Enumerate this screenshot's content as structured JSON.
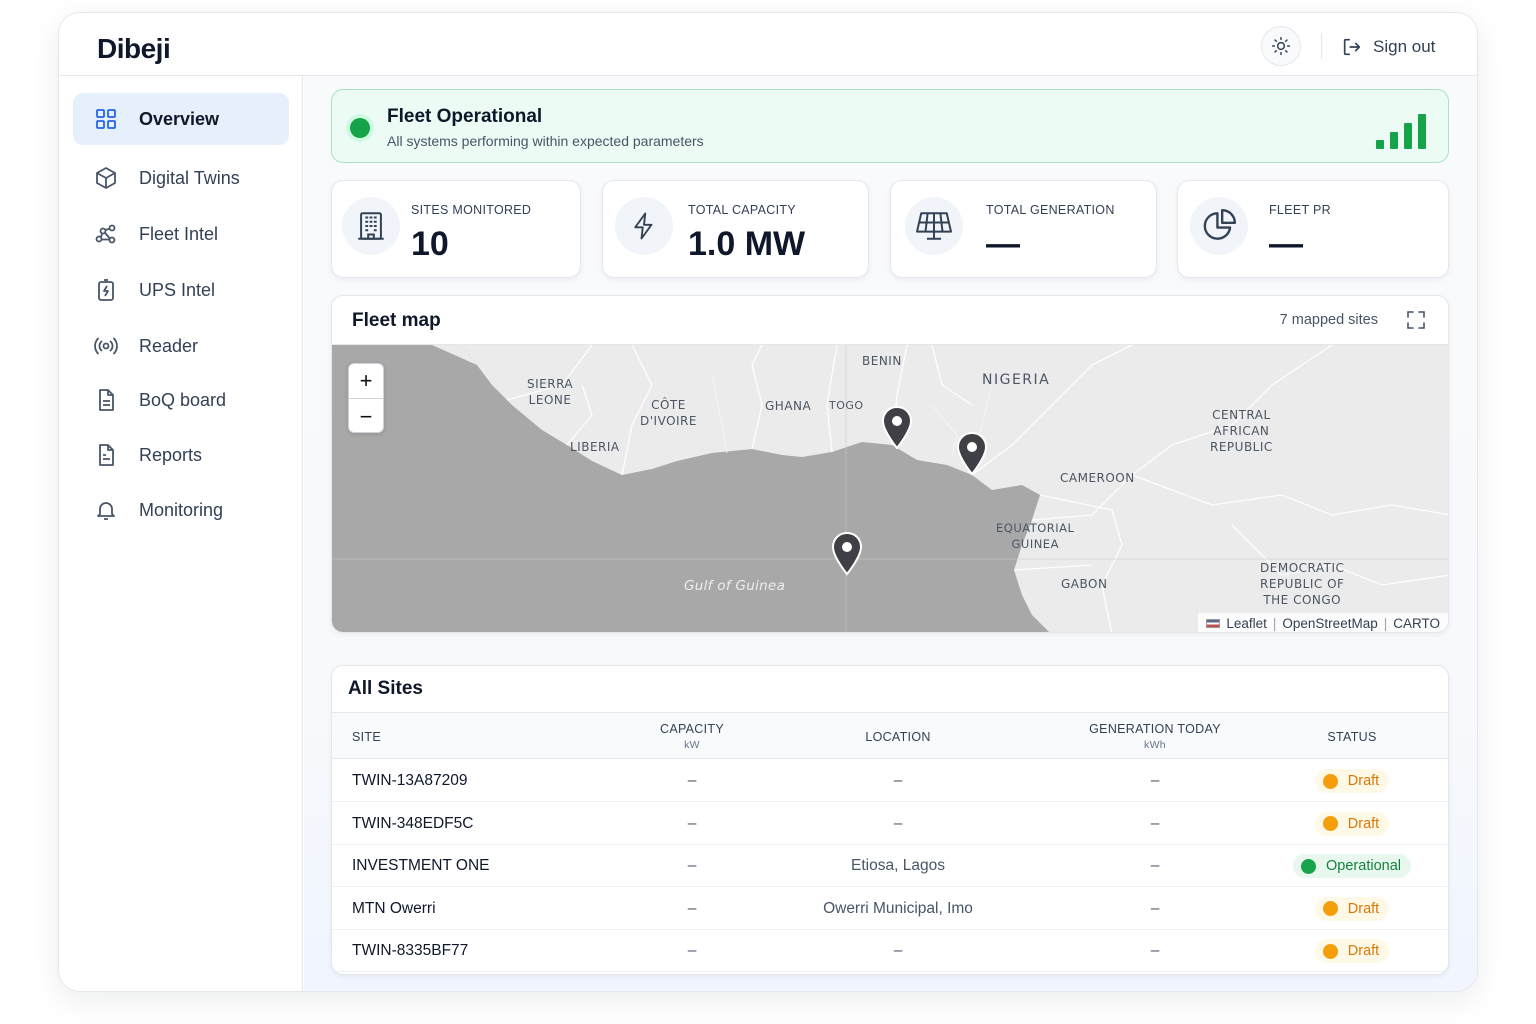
{
  "app": {
    "name": "Dibeji"
  },
  "header": {
    "theme_toggle_icon": "sun-icon",
    "signout_icon": "sign-out-icon",
    "signout_label": "Sign out"
  },
  "sidebar": {
    "items": [
      {
        "label": "Overview",
        "icon": "grid-icon",
        "active": true
      },
      {
        "label": "Digital Twins",
        "icon": "cube-icon",
        "active": false
      },
      {
        "label": "Fleet Intel",
        "icon": "network-icon",
        "active": false
      },
      {
        "label": "UPS Intel",
        "icon": "battery-bolt-icon",
        "active": false
      },
      {
        "label": "Reader",
        "icon": "broadcast-icon",
        "active": false
      },
      {
        "label": "BoQ board",
        "icon": "document-icon",
        "active": false
      },
      {
        "label": "Reports",
        "icon": "report-icon",
        "active": false
      },
      {
        "label": "Monitoring",
        "icon": "bell-icon",
        "active": false
      }
    ]
  },
  "banner": {
    "title": "Fleet Operational",
    "subtitle": "All systems performing within expected parameters",
    "status_color": "#16a34a",
    "signal_icon": "signal-bars-icon"
  },
  "stats": [
    {
      "label": "SITES MONITORED",
      "value": "10",
      "icon": "building-icon"
    },
    {
      "label": "TOTAL CAPACITY",
      "value": "1.0 MW",
      "icon": "lightning-icon"
    },
    {
      "label": "TOTAL GENERATION",
      "value": "—",
      "icon": "solar-panel-icon"
    },
    {
      "label": "FLEET PR",
      "value": "—",
      "icon": "pie-chart-icon"
    }
  ],
  "map": {
    "title": "Fleet map",
    "mapped_sites": "7 mapped sites",
    "zoom_in": "+",
    "zoom_out": "−",
    "labels": {
      "benin": "BENIN",
      "nigeria": "NIGERIA",
      "sierra_leone": "SIERRA\nLEONE",
      "cote_divoire": "CÔTE\nD'IVOIRE",
      "ghana": "GHANA",
      "togo": "TOGO",
      "liberia": "LIBERIA",
      "car": "CENTRAL\nAFRICAN\nREPUBLIC",
      "cameroon": "CAMEROON",
      "eq_guinea": "EQUATORIAL\nGUINEA",
      "gabon": "GABON",
      "drc": "DEMOCRATIC\nREPUBLIC OF\nTHE CONGO",
      "gulf": "Gulf of Guinea"
    },
    "attribution": {
      "leaflet": "Leaflet",
      "separator": "|",
      "osm": "OpenStreetMap",
      "carto": "CARTO"
    }
  },
  "sites": {
    "title": "All Sites",
    "columns": {
      "site": "SITE",
      "capacity": "CAPACITY",
      "capacity_unit": "kW",
      "location": "LOCATION",
      "generation": "GENERATION TODAY",
      "generation_unit": "kWh",
      "status": "STATUS"
    },
    "rows": [
      {
        "site": "TWIN-13A87209",
        "capacity": "–",
        "location": "–",
        "generation": "–",
        "status": "Draft"
      },
      {
        "site": "TWIN-348EDF5C",
        "capacity": "–",
        "location": "–",
        "generation": "–",
        "status": "Draft"
      },
      {
        "site": "INVESTMENT ONE",
        "capacity": "–",
        "location": "Etiosa, Lagos",
        "generation": "–",
        "status": "Operational"
      },
      {
        "site": "MTN Owerri",
        "capacity": "–",
        "location": "Owerri Municipal, Imo",
        "generation": "–",
        "status": "Draft"
      },
      {
        "site": "TWIN-8335BF77",
        "capacity": "–",
        "location": "–",
        "generation": "–",
        "status": "Draft"
      }
    ]
  }
}
